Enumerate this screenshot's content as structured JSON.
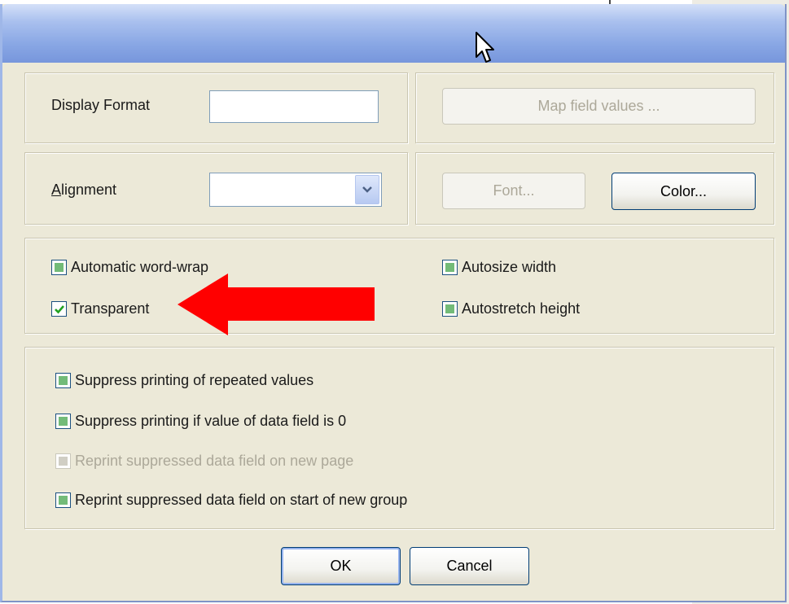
{
  "dialog": {
    "display_format": {
      "label": "Display Format",
      "value": ""
    },
    "map_field_values_label": "Map field values ...",
    "alignment": {
      "label_prefix": "A",
      "label_rest": "lignment",
      "value": ""
    },
    "font_label": "Font...",
    "color_label": "Color...",
    "checkboxes_top": [
      {
        "label": "Automatic word-wrap",
        "state": "indeterminate"
      },
      {
        "label": "Transparent",
        "state": "checked"
      },
      {
        "label": "Autosize width",
        "state": "indeterminate"
      },
      {
        "label": "Autostretch height",
        "state": "indeterminate"
      }
    ],
    "checkboxes_bottom": [
      {
        "label": "Suppress printing of repeated values",
        "state": "indeterminate"
      },
      {
        "label": "Suppress printing if value of data field is 0",
        "state": "indeterminate"
      },
      {
        "label": "Reprint suppressed data field on new page",
        "state": "disabled"
      },
      {
        "label": "Reprint suppressed data field on start of new group",
        "state": "indeterminate"
      }
    ],
    "ok_label": "OK",
    "cancel_label": "Cancel"
  },
  "colors": {
    "arrow": "#ff0000",
    "title_bar": "#88a6e4",
    "checkbox_fill": "#73bb78"
  },
  "icons": [
    "combo-dropdown-icon",
    "mouse-pointer-icon",
    "red-arrow-annotation",
    "checkmark-icon"
  ]
}
